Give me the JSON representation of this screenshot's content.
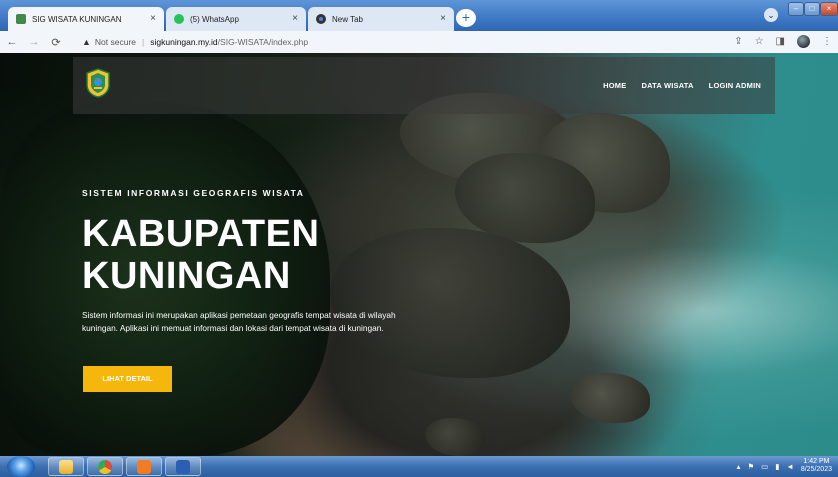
{
  "browser": {
    "tabs": [
      {
        "title": "SIG WISATA KUNINGAN",
        "active": true
      },
      {
        "title": "(5) WhatsApp",
        "active": false
      },
      {
        "title": "New Tab",
        "active": false
      }
    ],
    "close_glyph": "×",
    "new_tab_glyph": "+",
    "address": {
      "security_label": "Not secure",
      "host": "sigkuningan.my.id",
      "path": "/SIG-WISATA/index.php"
    }
  },
  "site": {
    "nav": [
      {
        "label": "HOME"
      },
      {
        "label": "DATA WISATA"
      },
      {
        "label": "LOGIN ADMIN"
      }
    ],
    "hero": {
      "subtitle": "SISTEM INFORMASI GEOGRAFIS WISATA",
      "title_line1": "KABUPATEN",
      "title_line2": "KUNINGAN",
      "description": "Sistem informasi ini merupakan aplikasi pemetaan geografis tempat wisata di wilayah kuningan. Aplikasi ini memuat informasi dan lokasi dari tempat wisata di kuningan.",
      "cta_label": "LIHAT DETAIL"
    },
    "colors": {
      "accent": "#f5b70c"
    }
  },
  "taskbar": {
    "clock_time": "1:42 PM",
    "clock_date": "8/25/2023",
    "apps": [
      "windows-explorer",
      "chrome",
      "xampp",
      "word"
    ]
  }
}
